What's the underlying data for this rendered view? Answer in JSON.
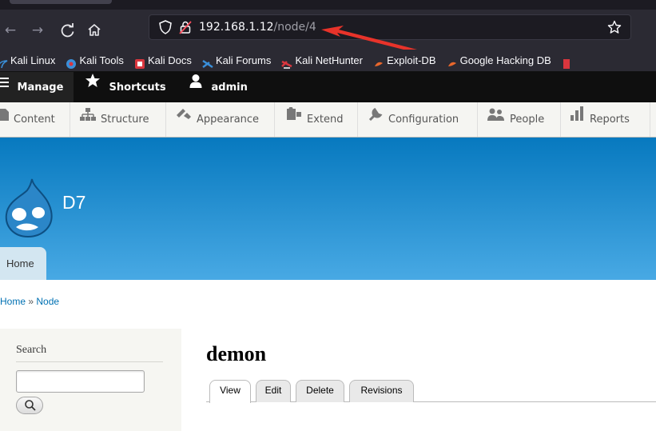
{
  "browser": {
    "url_host": "192.168.1.12",
    "url_path": "/node/4",
    "nav_icons": [
      "back-arrow-icon",
      "forward-arrow-icon",
      "reload-icon",
      "home-icon"
    ],
    "bookmarks": [
      {
        "label": "Kali Linux",
        "icon": "kali-dragon-icon",
        "color": "#3a8fd9"
      },
      {
        "label": "Kali Tools",
        "icon": "kali-tools-icon",
        "color": "#3a8fd9"
      },
      {
        "label": "Kali Docs",
        "icon": "kali-docs-icon",
        "color": "#d9363e"
      },
      {
        "label": "Kali Forums",
        "icon": "kali-forums-icon",
        "color": "#3a8fd9"
      },
      {
        "label": "Kali NetHunter",
        "icon": "nethunter-icon",
        "color": "#d9363e"
      },
      {
        "label": "Exploit-DB",
        "icon": "exploit-db-icon",
        "color": "#e8672c"
      },
      {
        "label": "Google Hacking DB",
        "icon": "ghdb-icon",
        "color": "#e8672c"
      }
    ]
  },
  "admin_toolbar": {
    "items": [
      {
        "label": "Manage",
        "icon": "menu-icon"
      },
      {
        "label": "Shortcuts",
        "icon": "star-icon"
      },
      {
        "label": "admin",
        "icon": "user-icon"
      }
    ]
  },
  "admin_tray": {
    "items": [
      {
        "label": "Content",
        "icon": "file-icon"
      },
      {
        "label": "Structure",
        "icon": "sitemap-icon"
      },
      {
        "label": "Appearance",
        "icon": "paintbrush-icon"
      },
      {
        "label": "Extend",
        "icon": "puzzle-icon"
      },
      {
        "label": "Configuration",
        "icon": "wrench-icon"
      },
      {
        "label": "People",
        "icon": "people-icon"
      },
      {
        "label": "Reports",
        "icon": "bar-chart-icon"
      }
    ]
  },
  "site": {
    "name": "D7",
    "home_tab": "Home",
    "colors": {
      "header_top": "#0779bf",
      "header_bottom": "#48a9e4",
      "link": "#0071b3"
    }
  },
  "breadcrumb": {
    "items": [
      "Home",
      "Node"
    ],
    "separator": "»"
  },
  "sidebar": {
    "search_title": "Search",
    "search_value": ""
  },
  "node": {
    "title": "demon",
    "tabs": [
      {
        "label": "View",
        "active": true
      },
      {
        "label": "Edit",
        "active": false
      },
      {
        "label": "Delete",
        "active": false
      },
      {
        "label": "Revisions",
        "active": false
      }
    ]
  }
}
